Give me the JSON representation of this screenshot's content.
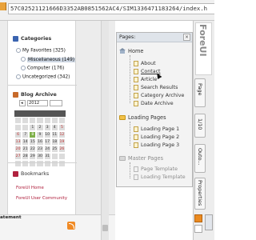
{
  "browser": {
    "url": "57C02521121666D3352AB0851562AC4/SIM1336471183264/index.h"
  },
  "sidebar_widgets": {
    "categories": {
      "title": "Categories",
      "items": [
        {
          "label": "My Favorites (325)"
        },
        {
          "label": "Miscellaneous (149)"
        },
        {
          "label": "Computer (176)"
        },
        {
          "label": "Uncategorized (342)"
        }
      ]
    },
    "blog_archive": {
      "title": "Blog Archive",
      "month_select": "◂",
      "year_select": "2012",
      "weeks": [
        [
          "",
          "",
          "",
          "",
          "",
          "",
          ""
        ],
        [
          "",
          "",
          "1",
          "2",
          "3",
          "4",
          "5"
        ],
        [
          "6",
          "7",
          "8",
          "9",
          "10",
          "11",
          "12"
        ],
        [
          "13",
          "14",
          "15",
          "16",
          "17",
          "18",
          "19"
        ],
        [
          "20",
          "21",
          "22",
          "23",
          "24",
          "25",
          "26"
        ],
        [
          "27",
          "28",
          "29",
          "30",
          "31",
          "",
          ""
        ],
        [
          "",
          "",
          "",
          "",
          "",
          "",
          ""
        ]
      ],
      "today": "8"
    },
    "bookmarks": {
      "title": "Bookmarks",
      "links": [
        {
          "label": "ForeUI Home"
        },
        {
          "label": "ForeUI User Community"
        }
      ]
    },
    "footer_label": "atement"
  },
  "pages_panel": {
    "title": "Pages:",
    "close_label": "×",
    "sections": [
      {
        "label": "Home",
        "state": "active",
        "pages": [
          "About",
          "Contact",
          "Article",
          "Search Results",
          "Category Archive",
          "Date Archive"
        ],
        "selected": "Contact"
      },
      {
        "label": "Loading Pages",
        "state": "active",
        "pages": [
          "Loading Page 1",
          "Loading Page 2",
          "Loading Page 3"
        ]
      },
      {
        "label": "Master Pages",
        "state": "inactive",
        "pages": [
          "Page Template",
          "Loading Template"
        ]
      }
    ]
  },
  "right_strip": {
    "logo": "ForeUI",
    "tabs": [
      "Page",
      "1/10",
      "Outo...",
      "Properties"
    ]
  },
  "colors": {
    "accent_orange": "#eb8a1f",
    "today_green": "#7fb04a",
    "link_red": "#b0213e",
    "folder_yellow": "#f2c24a"
  }
}
